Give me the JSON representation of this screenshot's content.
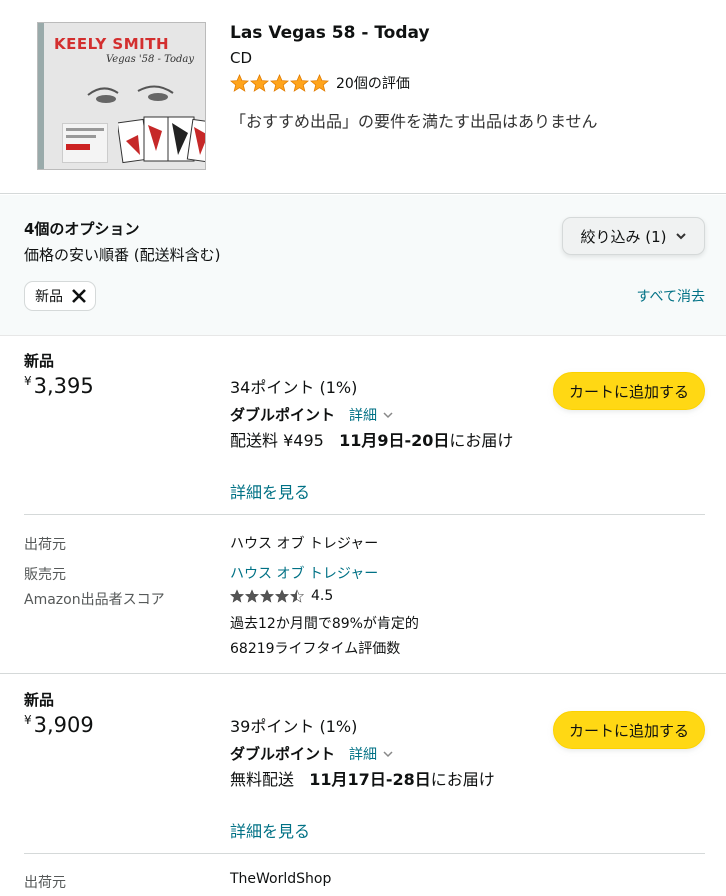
{
  "product": {
    "cover_artist": "KEELY SMITH",
    "cover_album": "Vegas '58 - Today",
    "title": "Las Vegas 58 - Today",
    "format": "CD",
    "rating_stars": 5,
    "rating_count": "20個の評価",
    "notice": "「おすすめ出品」の要件を満たす出品はありません"
  },
  "filters": {
    "options_count": "4個のオプション",
    "sort_label": "価格の安い順番 (配送料含む)",
    "filter_button": "絞り込み (1)",
    "chip_label": "新品",
    "clear_all": "すべて消去"
  },
  "offers": [
    {
      "condition": "新品",
      "price_symbol": "¥",
      "price": "3,395",
      "points": "34ポイント (1%)",
      "double_point": "ダブルポイント",
      "detail": "詳細",
      "ship_prefix": "配送料 ¥495",
      "ship_date": "11月9日-20日",
      "ship_suffix": "にお届け",
      "see_more": "詳細を見る",
      "cart": "カートに追加する",
      "shipper_label": "出荷元",
      "shipper": "ハウス オブ トレジャー",
      "seller_label": "販売元",
      "seller": "ハウス オブ トレジャー",
      "score_label": "Amazon出品者スコア",
      "score": "4.5",
      "score_stars": 4.5,
      "positive": "過去12か月間で89%が肯定的",
      "lifetime": "68219ライフタイム評価数"
    },
    {
      "condition": "新品",
      "price_symbol": "¥",
      "price": "3,909",
      "points": "39ポイント (1%)",
      "double_point": "ダブルポイント",
      "detail": "詳細",
      "ship_prefix": "無料配送",
      "ship_date": "11月17日-28日",
      "ship_suffix": "にお届け",
      "see_more": "詳細を見る",
      "cart": "カートに追加する",
      "shipper_label": "出荷元",
      "shipper": "TheWorldShop"
    }
  ],
  "colors": {
    "star": "#ffa41c",
    "link": "#007185",
    "cart_button": "#ffd814"
  }
}
